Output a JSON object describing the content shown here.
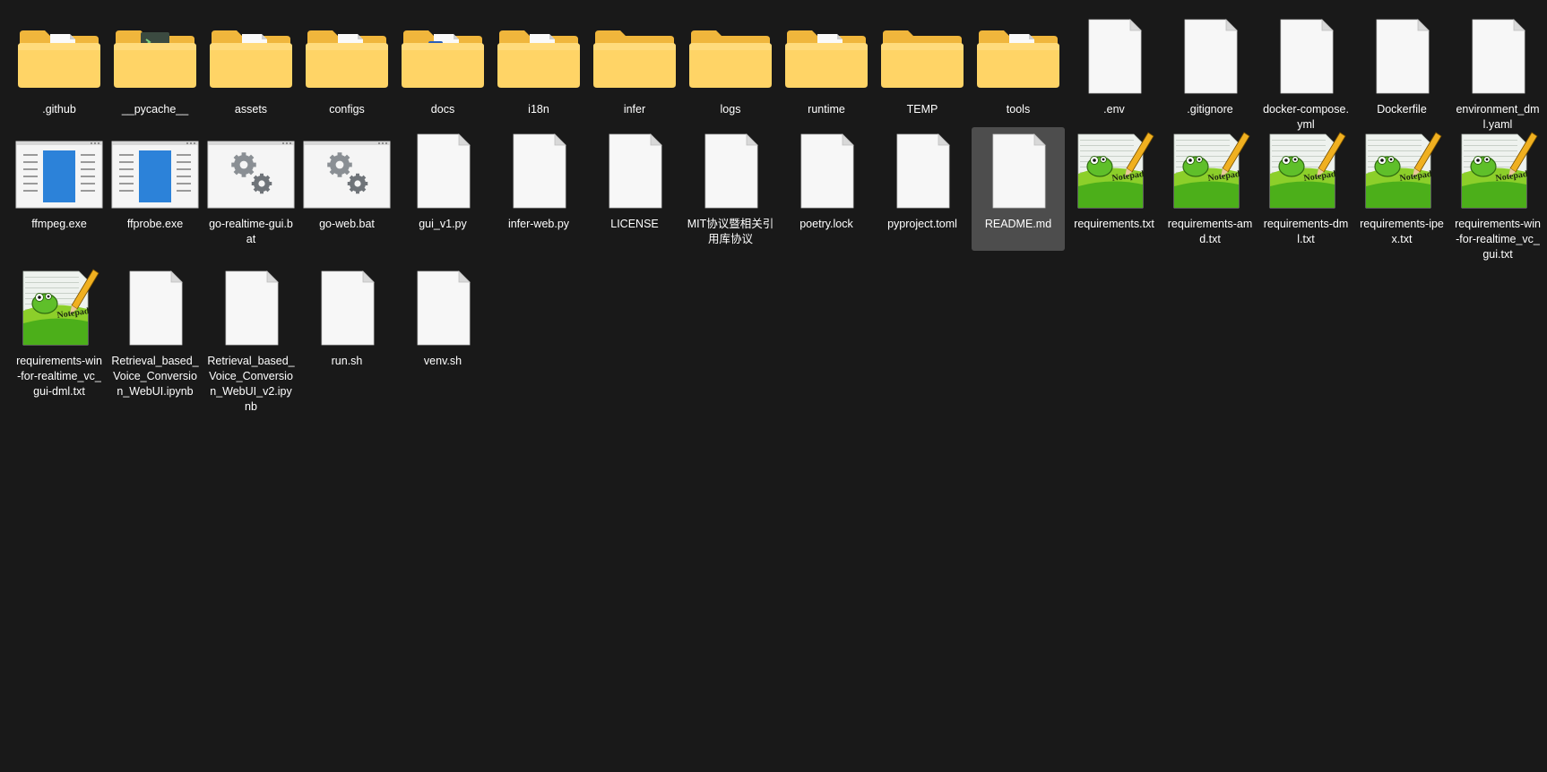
{
  "window": {
    "view": "large-icons",
    "theme": "dark"
  },
  "colors": {
    "background": "#191919",
    "selection": "#4d4d4d",
    "folder_back": "#f0b63c",
    "folder_front": "#ffd466",
    "doc_page": "#f7f7f7",
    "doc_fold": "#d8d8d8",
    "app_blue": "#1b78d6",
    "gear_gray": "#8a8f94",
    "notepad_green": "#4caf1a"
  },
  "items": [
    {
      "name": ".github",
      "icon": "folder-doc-icon"
    },
    {
      "name": "__pycache__",
      "icon": "folder-python-icon"
    },
    {
      "name": "assets",
      "icon": "folder-doc-icon"
    },
    {
      "name": "configs",
      "icon": "folder-doc-icon"
    },
    {
      "name": "docs",
      "icon": "folder-word-icon"
    },
    {
      "name": "i18n",
      "icon": "folder-doc-icon"
    },
    {
      "name": "infer",
      "icon": "folder-icon"
    },
    {
      "name": "logs",
      "icon": "folder-icon"
    },
    {
      "name": "runtime",
      "icon": "folder-doc-icon"
    },
    {
      "name": "TEMP",
      "icon": "folder-icon"
    },
    {
      "name": "tools",
      "icon": "folder-doc-icon"
    },
    {
      "name": ".env",
      "icon": "file-icon"
    },
    {
      "name": ".gitignore",
      "icon": "file-icon"
    },
    {
      "name": "docker-compose.yml",
      "icon": "file-icon"
    },
    {
      "name": "Dockerfile",
      "icon": "file-icon"
    },
    {
      "name": "environment_dml.yaml",
      "icon": "file-icon"
    },
    {
      "name": "ffmpeg.exe",
      "icon": "exe-app-icon"
    },
    {
      "name": "ffprobe.exe",
      "icon": "exe-app-icon"
    },
    {
      "name": "go-realtime-gui.bat",
      "icon": "batch-gear-icon"
    },
    {
      "name": "go-web.bat",
      "icon": "batch-gear-icon"
    },
    {
      "name": "gui_v1.py",
      "icon": "file-icon"
    },
    {
      "name": "infer-web.py",
      "icon": "file-icon"
    },
    {
      "name": "LICENSE",
      "icon": "file-icon"
    },
    {
      "name": "MIT协议暨相关引用库协议",
      "icon": "file-icon"
    },
    {
      "name": "poetry.lock",
      "icon": "file-icon"
    },
    {
      "name": "pyproject.toml",
      "icon": "file-icon"
    },
    {
      "name": "README.md",
      "icon": "file-icon",
      "selected": true
    },
    {
      "name": "requirements.txt",
      "icon": "notepad-plus-plus-icon"
    },
    {
      "name": "requirements-amd.txt",
      "icon": "notepad-plus-plus-icon"
    },
    {
      "name": "requirements-dml.txt",
      "icon": "notepad-plus-plus-icon"
    },
    {
      "name": "requirements-ipex.txt",
      "icon": "notepad-plus-plus-icon"
    },
    {
      "name": "requirements-win-for-realtime_vc_gui.txt",
      "icon": "notepad-plus-plus-icon"
    },
    {
      "name": "requirements-win-for-realtime_vc_gui-dml.txt",
      "icon": "notepad-plus-plus-icon"
    },
    {
      "name": "Retrieval_based_Voice_Conversion_WebUI.ipynb",
      "icon": "file-icon"
    },
    {
      "name": "Retrieval_based_Voice_Conversion_WebUI_v2.ipynb",
      "icon": "file-icon"
    },
    {
      "name": "run.sh",
      "icon": "file-icon"
    },
    {
      "name": "venv.sh",
      "icon": "file-icon"
    }
  ]
}
